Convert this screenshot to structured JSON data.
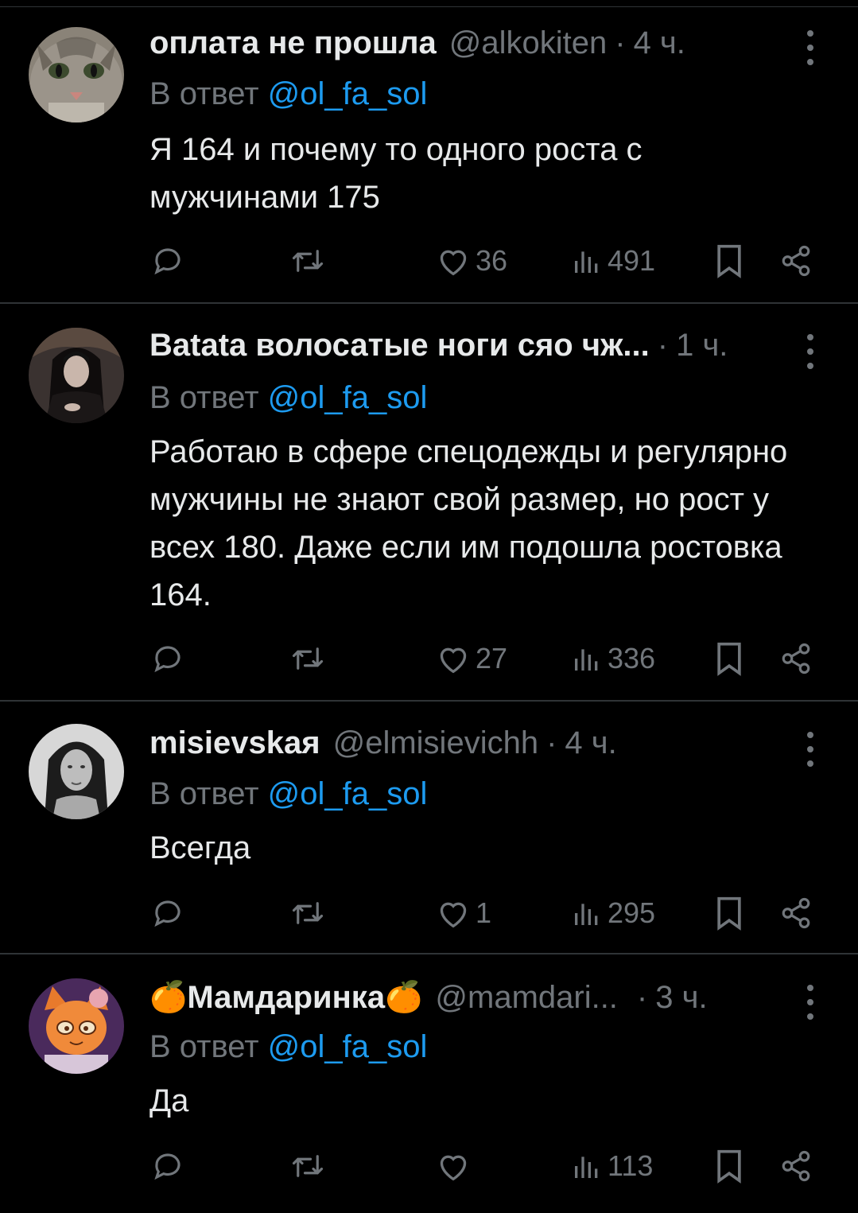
{
  "tweets": [
    {
      "name": "оплата не прошла",
      "handle": "@alkokiten",
      "time": "4 ч.",
      "reply_prefix": "В ответ",
      "reply_mention": "@ol_fa_sol",
      "text": "Я 164 и почему то одного роста с мужчинами 175",
      "likes": "36",
      "views": "491",
      "avatar": "cat-face"
    },
    {
      "name": "Batata волосатые ноги сяо чж...",
      "handle": "",
      "time": "1 ч.",
      "reply_prefix": "В ответ",
      "reply_mention": "@ol_fa_sol",
      "text": "Работаю в сфере спецодежды и регулярно мужчины не знают свой размер, но рост у всех 180. Даже если им подошла ростовка 164.",
      "likes": "27",
      "views": "336",
      "avatar": "dark-haired-woman"
    },
    {
      "name": "misievskaя",
      "handle": "@elmisievichh",
      "time": "4 ч.",
      "reply_prefix": "В ответ",
      "reply_mention": "@ol_fa_sol",
      "text": "Всегда",
      "likes": "1",
      "views": "295",
      "avatar": "woman-portrait-bw"
    },
    {
      "name": "Мамдаринка",
      "name_emoji": "🍊",
      "handle": "@mamdari...",
      "time": "3 ч.",
      "reply_prefix": "В ответ",
      "reply_mention": "@ol_fa_sol",
      "text": "Да",
      "likes": "",
      "views": "113",
      "avatar": "orange-cartoon-character"
    }
  ],
  "colors": {
    "background": "#000000",
    "text": "#e7e9ea",
    "secondary": "#71767b",
    "link": "#1d9bf0",
    "divider": "#2f3336"
  },
  "icons": [
    "reply-icon",
    "retweet-icon",
    "like-icon",
    "views-icon",
    "bookmark-icon",
    "share-icon",
    "more-icon"
  ]
}
